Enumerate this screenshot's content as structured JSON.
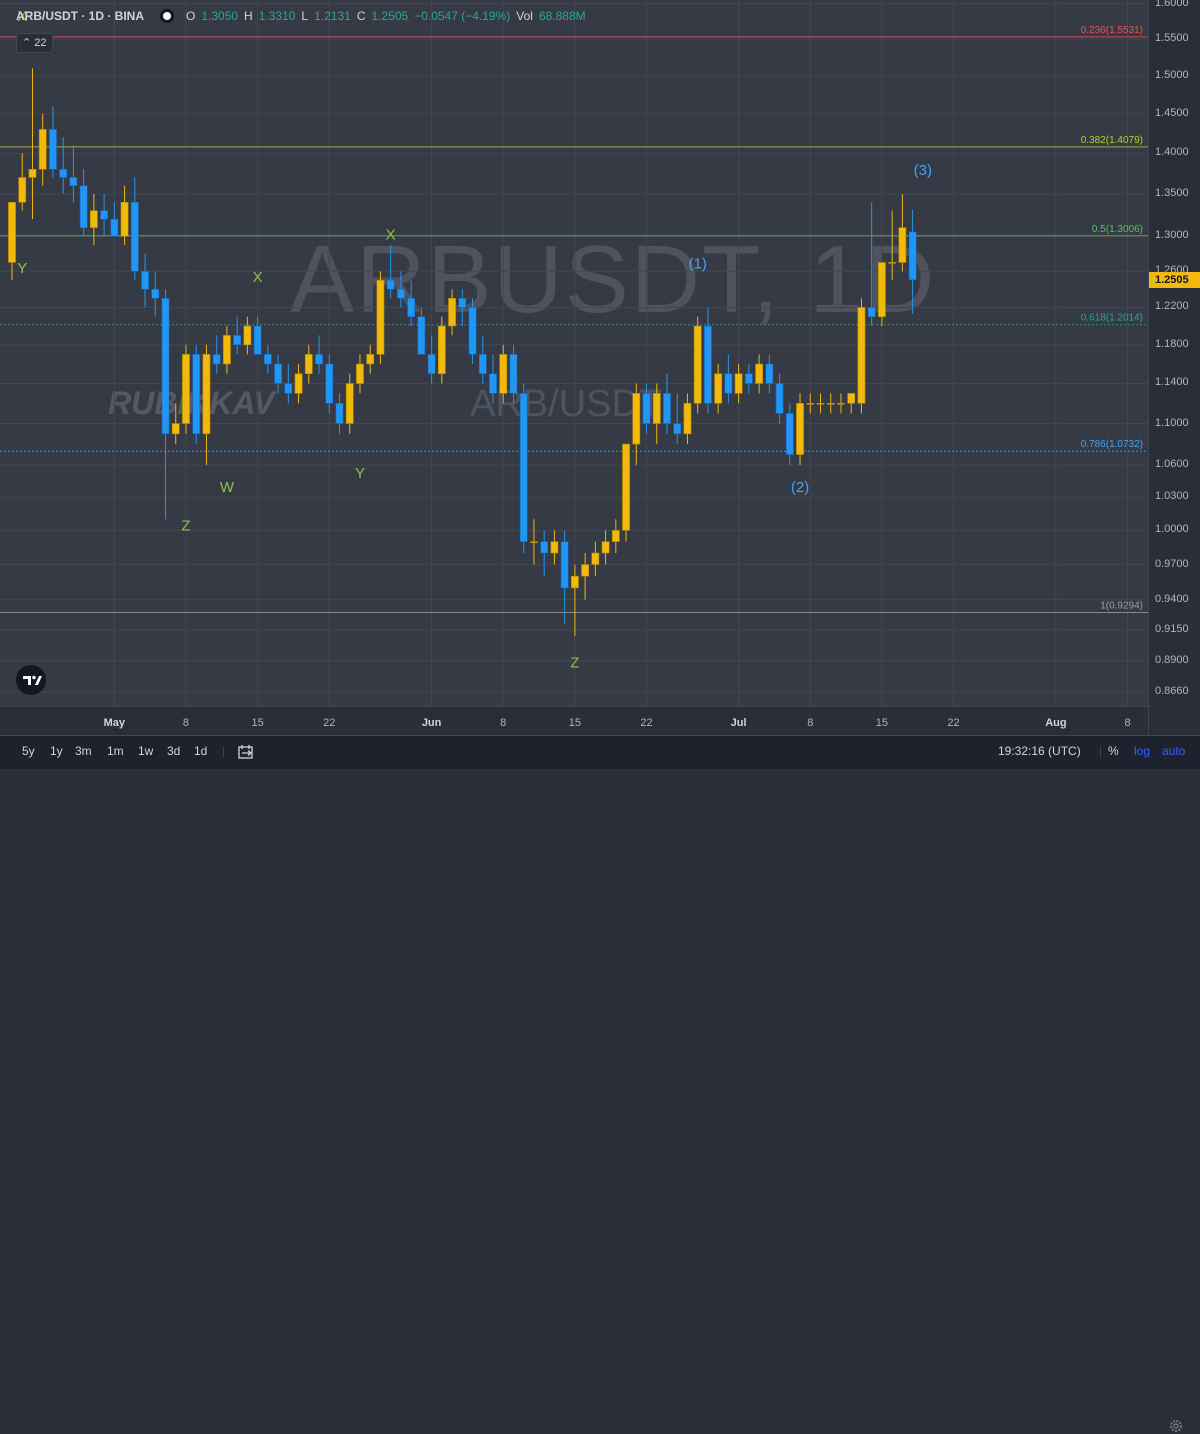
{
  "legend": {
    "symbol": "ARB/USDT · 1D · BINA",
    "open_label": "O",
    "open": "1.3050",
    "high_label": "H",
    "high": "1.3310",
    "low_label": "L",
    "low": "1.2131",
    "close_label": "C",
    "close": "1.2505",
    "change": "−0.0547 (−4.19%)",
    "vol_label": "Vol",
    "vol": "68.888M"
  },
  "indicator_badge": "22",
  "watermark": {
    "main": "ARBUSDT, 1D",
    "author": "RUBIKKAV",
    "secondary": "ARB/USDT"
  },
  "price_axis": {
    "ticks": [
      "1.6000",
      "1.5500",
      "1.5000",
      "1.4500",
      "1.4000",
      "1.3500",
      "1.3000",
      "1.2600",
      "1.2200",
      "1.1800",
      "1.1400",
      "1.1000",
      "1.0600",
      "1.0300",
      "1.0000",
      "0.9700",
      "0.9400",
      "0.9150",
      "0.8900",
      "0.8660"
    ],
    "current_price": "1.2505",
    "current_color": "#f0b90b"
  },
  "fib_labels": [
    {
      "text": "0.236(1.5531)",
      "price": 1.5531,
      "color": "#ef5350"
    },
    {
      "text": "0.382(1.4079)",
      "price": 1.4079,
      "color": "#c0ca33"
    },
    {
      "text": "0.5(1.3006)",
      "price": 1.3006,
      "color": "#66bb6a"
    },
    {
      "text": "0.618(1.2014)",
      "price": 1.2014,
      "color": "#26a69a"
    },
    {
      "text": "0.786(1.0732)",
      "price": 1.0732,
      "color": "#42a5f5"
    },
    {
      "text": "1(0.9294)",
      "price": 0.9294,
      "color": "#9e9e9e"
    }
  ],
  "wave_labels": [
    {
      "text": "X",
      "date": "2023-04-22",
      "price": 1.575,
      "color": "#8bc34a"
    },
    {
      "text": "Y",
      "date": "2023-04-22",
      "price": 1.258,
      "color": "#8bc34a"
    },
    {
      "text": "Z",
      "date": "2023-05-08",
      "price": 1.0,
      "color": "#8bc34a"
    },
    {
      "text": "W",
      "date": "2023-05-12",
      "price": 1.035,
      "color": "#8bc34a"
    },
    {
      "text": "X",
      "date": "2023-05-15",
      "price": 1.248,
      "color": "#8bc34a"
    },
    {
      "text": "Y",
      "date": "2023-05-25",
      "price": 1.048,
      "color": "#8bc34a"
    },
    {
      "text": "X",
      "date": "2023-05-28",
      "price": 1.296,
      "color": "#8bc34a"
    },
    {
      "text": "Z",
      "date": "2023-06-15",
      "price": 0.885,
      "color": "#8bc34a"
    },
    {
      "text": "(1)",
      "date": "2023-06-27",
      "price": 1.263,
      "color": "#42a5f5"
    },
    {
      "text": "(2)",
      "date": "2023-07-07",
      "price": 1.035,
      "color": "#42a5f5"
    },
    {
      "text": "(3)",
      "date": "2023-07-19",
      "price": 1.373,
      "color": "#42a5f5"
    }
  ],
  "time_axis": {
    "labels": [
      {
        "text": "May",
        "date": "2023-05-01",
        "bold": true
      },
      {
        "text": "8",
        "date": "2023-05-08",
        "bold": false
      },
      {
        "text": "15",
        "date": "2023-05-15",
        "bold": false
      },
      {
        "text": "22",
        "date": "2023-05-22",
        "bold": false
      },
      {
        "text": "Jun",
        "date": "2023-06-01",
        "bold": true
      },
      {
        "text": "8",
        "date": "2023-06-08",
        "bold": false
      },
      {
        "text": "15",
        "date": "2023-06-15",
        "bold": false
      },
      {
        "text": "22",
        "date": "2023-06-22",
        "bold": false
      },
      {
        "text": "Jul",
        "date": "2023-07-01",
        "bold": true
      },
      {
        "text": "8",
        "date": "2023-07-08",
        "bold": false
      },
      {
        "text": "15",
        "date": "2023-07-15",
        "bold": false
      },
      {
        "text": "22",
        "date": "2023-07-22",
        "bold": false
      },
      {
        "text": "Aug",
        "date": "2023-08-01",
        "bold": true
      },
      {
        "text": "8",
        "date": "2023-08-08",
        "bold": false
      }
    ]
  },
  "bottom_bar": {
    "ranges": [
      "5y",
      "1y",
      "3m",
      "1m",
      "1w",
      "3d",
      "1d"
    ],
    "clock": "19:32:16 (UTC)",
    "percent": "%",
    "log": "log",
    "auto": "auto"
  },
  "chart_data": {
    "type": "candlestick",
    "title": "ARB/USDT · 1D · BINA",
    "ylim": [
      0.855,
      1.605
    ],
    "xlim": [
      "2023-04-21",
      "2023-08-10"
    ],
    "y_scale": "log",
    "grid": true,
    "colors": {
      "up": "#f0b90b",
      "down": "#2196f3"
    },
    "candles": [
      {
        "date": "2023-04-21",
        "o": 1.27,
        "h": 1.3,
        "l": 1.25,
        "c": 1.34
      },
      {
        "date": "2023-04-22",
        "o": 1.34,
        "h": 1.4,
        "l": 1.33,
        "c": 1.37
      },
      {
        "date": "2023-04-23",
        "o": 1.37,
        "h": 1.51,
        "l": 1.32,
        "c": 1.38
      },
      {
        "date": "2023-04-24",
        "o": 1.38,
        "h": 1.45,
        "l": 1.36,
        "c": 1.43
      },
      {
        "date": "2023-04-25",
        "o": 1.43,
        "h": 1.46,
        "l": 1.37,
        "c": 1.38
      },
      {
        "date": "2023-04-26",
        "o": 1.38,
        "h": 1.42,
        "l": 1.35,
        "c": 1.37
      },
      {
        "date": "2023-04-27",
        "o": 1.37,
        "h": 1.41,
        "l": 1.34,
        "c": 1.36
      },
      {
        "date": "2023-04-28",
        "o": 1.36,
        "h": 1.38,
        "l": 1.3,
        "c": 1.31
      },
      {
        "date": "2023-04-29",
        "o": 1.31,
        "h": 1.35,
        "l": 1.29,
        "c": 1.33
      },
      {
        "date": "2023-04-30",
        "o": 1.33,
        "h": 1.35,
        "l": 1.3,
        "c": 1.32
      },
      {
        "date": "2023-05-01",
        "o": 1.32,
        "h": 1.34,
        "l": 1.3,
        "c": 1.3
      },
      {
        "date": "2023-05-02",
        "o": 1.3,
        "h": 1.36,
        "l": 1.29,
        "c": 1.34
      },
      {
        "date": "2023-05-03",
        "o": 1.34,
        "h": 1.37,
        "l": 1.25,
        "c": 1.26
      },
      {
        "date": "2023-05-04",
        "o": 1.26,
        "h": 1.28,
        "l": 1.22,
        "c": 1.24
      },
      {
        "date": "2023-05-05",
        "o": 1.24,
        "h": 1.26,
        "l": 1.21,
        "c": 1.23
      },
      {
        "date": "2023-05-06",
        "o": 1.23,
        "h": 1.24,
        "l": 1.01,
        "c": 1.09
      },
      {
        "date": "2023-05-07",
        "o": 1.09,
        "h": 1.12,
        "l": 1.08,
        "c": 1.1
      },
      {
        "date": "2023-05-08",
        "o": 1.1,
        "h": 1.18,
        "l": 1.09,
        "c": 1.17
      },
      {
        "date": "2023-05-09",
        "o": 1.17,
        "h": 1.18,
        "l": 1.08,
        "c": 1.09
      },
      {
        "date": "2023-05-10",
        "o": 1.09,
        "h": 1.18,
        "l": 1.06,
        "c": 1.17
      },
      {
        "date": "2023-05-11",
        "o": 1.17,
        "h": 1.19,
        "l": 1.15,
        "c": 1.16
      },
      {
        "date": "2023-05-12",
        "o": 1.16,
        "h": 1.2,
        "l": 1.15,
        "c": 1.19
      },
      {
        "date": "2023-05-13",
        "o": 1.19,
        "h": 1.21,
        "l": 1.17,
        "c": 1.18
      },
      {
        "date": "2023-05-14",
        "o": 1.18,
        "h": 1.21,
        "l": 1.17,
        "c": 1.2
      },
      {
        "date": "2023-05-15",
        "o": 1.2,
        "h": 1.21,
        "l": 1.18,
        "c": 1.17
      },
      {
        "date": "2023-05-16",
        "o": 1.17,
        "h": 1.18,
        "l": 1.15,
        "c": 1.16
      },
      {
        "date": "2023-05-17",
        "o": 1.16,
        "h": 1.17,
        "l": 1.13,
        "c": 1.14
      },
      {
        "date": "2023-05-18",
        "o": 1.14,
        "h": 1.16,
        "l": 1.12,
        "c": 1.13
      },
      {
        "date": "2023-05-19",
        "o": 1.13,
        "h": 1.16,
        "l": 1.12,
        "c": 1.15
      },
      {
        "date": "2023-05-20",
        "o": 1.15,
        "h": 1.18,
        "l": 1.14,
        "c": 1.17
      },
      {
        "date": "2023-05-21",
        "o": 1.17,
        "h": 1.19,
        "l": 1.15,
        "c": 1.16
      },
      {
        "date": "2023-05-22",
        "o": 1.16,
        "h": 1.17,
        "l": 1.11,
        "c": 1.12
      },
      {
        "date": "2023-05-23",
        "o": 1.12,
        "h": 1.13,
        "l": 1.09,
        "c": 1.1
      },
      {
        "date": "2023-05-24",
        "o": 1.1,
        "h": 1.15,
        "l": 1.09,
        "c": 1.14
      },
      {
        "date": "2023-05-25",
        "o": 1.14,
        "h": 1.17,
        "l": 1.13,
        "c": 1.16
      },
      {
        "date": "2023-05-26",
        "o": 1.16,
        "h": 1.18,
        "l": 1.15,
        "c": 1.17
      },
      {
        "date": "2023-05-27",
        "o": 1.17,
        "h": 1.26,
        "l": 1.16,
        "c": 1.25
      },
      {
        "date": "2023-05-28",
        "o": 1.25,
        "h": 1.29,
        "l": 1.23,
        "c": 1.24
      },
      {
        "date": "2023-05-29",
        "o": 1.24,
        "h": 1.26,
        "l": 1.22,
        "c": 1.23
      },
      {
        "date": "2023-05-30",
        "o": 1.23,
        "h": 1.25,
        "l": 1.2,
        "c": 1.21
      },
      {
        "date": "2023-05-31",
        "o": 1.21,
        "h": 1.22,
        "l": 1.17,
        "c": 1.17
      },
      {
        "date": "2023-06-01",
        "o": 1.17,
        "h": 1.19,
        "l": 1.14,
        "c": 1.15
      },
      {
        "date": "2023-06-02",
        "o": 1.15,
        "h": 1.21,
        "l": 1.14,
        "c": 1.2
      },
      {
        "date": "2023-06-03",
        "o": 1.2,
        "h": 1.24,
        "l": 1.19,
        "c": 1.23
      },
      {
        "date": "2023-06-04",
        "o": 1.23,
        "h": 1.24,
        "l": 1.2,
        "c": 1.22
      },
      {
        "date": "2023-06-05",
        "o": 1.22,
        "h": 1.23,
        "l": 1.16,
        "c": 1.17
      },
      {
        "date": "2023-06-06",
        "o": 1.17,
        "h": 1.19,
        "l": 1.14,
        "c": 1.15
      },
      {
        "date": "2023-06-07",
        "o": 1.15,
        "h": 1.17,
        "l": 1.12,
        "c": 1.13
      },
      {
        "date": "2023-06-08",
        "o": 1.13,
        "h": 1.18,
        "l": 1.12,
        "c": 1.17
      },
      {
        "date": "2023-06-09",
        "o": 1.17,
        "h": 1.18,
        "l": 1.12,
        "c": 1.13
      },
      {
        "date": "2023-06-10",
        "o": 1.13,
        "h": 1.14,
        "l": 0.98,
        "c": 0.99
      },
      {
        "date": "2023-06-11",
        "o": 0.99,
        "h": 1.01,
        "l": 0.97,
        "c": 0.99
      },
      {
        "date": "2023-06-12",
        "o": 0.99,
        "h": 1.0,
        "l": 0.96,
        "c": 0.98
      },
      {
        "date": "2023-06-13",
        "o": 0.98,
        "h": 1.0,
        "l": 0.97,
        "c": 0.99
      },
      {
        "date": "2023-06-14",
        "o": 0.99,
        "h": 1.0,
        "l": 0.92,
        "c": 0.95
      },
      {
        "date": "2023-06-15",
        "o": 0.95,
        "h": 0.97,
        "l": 0.91,
        "c": 0.96
      },
      {
        "date": "2023-06-16",
        "o": 0.96,
        "h": 0.98,
        "l": 0.94,
        "c": 0.97
      },
      {
        "date": "2023-06-17",
        "o": 0.97,
        "h": 0.99,
        "l": 0.96,
        "c": 0.98
      },
      {
        "date": "2023-06-18",
        "o": 0.98,
        "h": 1.0,
        "l": 0.97,
        "c": 0.99
      },
      {
        "date": "2023-06-19",
        "o": 0.99,
        "h": 1.01,
        "l": 0.98,
        "c": 1.0
      },
      {
        "date": "2023-06-20",
        "o": 1.0,
        "h": 1.08,
        "l": 0.99,
        "c": 1.08
      },
      {
        "date": "2023-06-21",
        "o": 1.08,
        "h": 1.14,
        "l": 1.06,
        "c": 1.13
      },
      {
        "date": "2023-06-22",
        "o": 1.13,
        "h": 1.14,
        "l": 1.09,
        "c": 1.1
      },
      {
        "date": "2023-06-23",
        "o": 1.1,
        "h": 1.14,
        "l": 1.08,
        "c": 1.13
      },
      {
        "date": "2023-06-24",
        "o": 1.13,
        "h": 1.15,
        "l": 1.09,
        "c": 1.1
      },
      {
        "date": "2023-06-25",
        "o": 1.1,
        "h": 1.13,
        "l": 1.08,
        "c": 1.09
      },
      {
        "date": "2023-06-26",
        "o": 1.09,
        "h": 1.13,
        "l": 1.08,
        "c": 1.12
      },
      {
        "date": "2023-06-27",
        "o": 1.12,
        "h": 1.21,
        "l": 1.11,
        "c": 1.2
      },
      {
        "date": "2023-06-28",
        "o": 1.2,
        "h": 1.22,
        "l": 1.11,
        "c": 1.12
      },
      {
        "date": "2023-06-29",
        "o": 1.12,
        "h": 1.16,
        "l": 1.11,
        "c": 1.15
      },
      {
        "date": "2023-06-30",
        "o": 1.15,
        "h": 1.17,
        "l": 1.12,
        "c": 1.13
      },
      {
        "date": "2023-07-01",
        "o": 1.13,
        "h": 1.16,
        "l": 1.12,
        "c": 1.15
      },
      {
        "date": "2023-07-02",
        "o": 1.15,
        "h": 1.16,
        "l": 1.13,
        "c": 1.14
      },
      {
        "date": "2023-07-03",
        "o": 1.14,
        "h": 1.17,
        "l": 1.13,
        "c": 1.16
      },
      {
        "date": "2023-07-04",
        "o": 1.16,
        "h": 1.17,
        "l": 1.13,
        "c": 1.14
      },
      {
        "date": "2023-07-05",
        "o": 1.14,
        "h": 1.15,
        "l": 1.1,
        "c": 1.11
      },
      {
        "date": "2023-07-06",
        "o": 1.11,
        "h": 1.12,
        "l": 1.06,
        "c": 1.07
      },
      {
        "date": "2023-07-07",
        "o": 1.07,
        "h": 1.13,
        "l": 1.06,
        "c": 1.12
      },
      {
        "date": "2023-07-08",
        "o": 1.12,
        "h": 1.13,
        "l": 1.11,
        "c": 1.12
      },
      {
        "date": "2023-07-09",
        "o": 1.12,
        "h": 1.13,
        "l": 1.11,
        "c": 1.12
      },
      {
        "date": "2023-07-10",
        "o": 1.12,
        "h": 1.13,
        "l": 1.11,
        "c": 1.12
      },
      {
        "date": "2023-07-11",
        "o": 1.12,
        "h": 1.13,
        "l": 1.11,
        "c": 1.12
      },
      {
        "date": "2023-07-12",
        "o": 1.12,
        "h": 1.13,
        "l": 1.11,
        "c": 1.13
      },
      {
        "date": "2023-07-13",
        "o": 1.12,
        "h": 1.23,
        "l": 1.11,
        "c": 1.22
      },
      {
        "date": "2023-07-14",
        "o": 1.22,
        "h": 1.34,
        "l": 1.2,
        "c": 1.21
      },
      {
        "date": "2023-07-15",
        "o": 1.21,
        "h": 1.27,
        "l": 1.2,
        "c": 1.27
      },
      {
        "date": "2023-07-16",
        "o": 1.27,
        "h": 1.33,
        "l": 1.25,
        "c": 1.27
      },
      {
        "date": "2023-07-17",
        "o": 1.27,
        "h": 1.35,
        "l": 1.26,
        "c": 1.31
      },
      {
        "date": "2023-07-18",
        "o": 1.305,
        "h": 1.331,
        "l": 1.2131,
        "c": 1.2505
      }
    ]
  }
}
